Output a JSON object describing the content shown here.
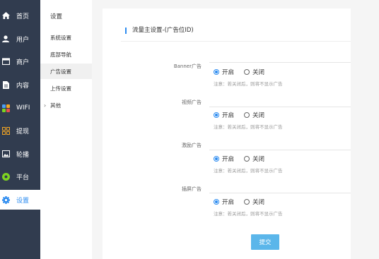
{
  "sidebar": {
    "items": [
      {
        "label": "首页",
        "icon": "home-icon",
        "color": "#ffffff"
      },
      {
        "label": "用户",
        "icon": "user-icon",
        "color": "#ffffff"
      },
      {
        "label": "商户",
        "icon": "store-icon",
        "color": "#ffffff"
      },
      {
        "label": "内容",
        "icon": "document-icon",
        "color": "#ffffff"
      },
      {
        "label": "WIFI",
        "icon": "wifi-apps-icon",
        "color": "#4a9ff5"
      },
      {
        "label": "提现",
        "icon": "grid-icon",
        "color": "#f5a623"
      },
      {
        "label": "轮播",
        "icon": "image-icon",
        "color": "#ffffff"
      },
      {
        "label": "平台",
        "icon": "platform-icon",
        "color": "#7ed321"
      },
      {
        "label": "设置",
        "icon": "gear-icon",
        "color": "#2d8cf0"
      }
    ],
    "active_index": 8
  },
  "submenu": {
    "title": "设置",
    "items": [
      {
        "label": "系统设置"
      },
      {
        "label": "底部导航"
      },
      {
        "label": "广告设置"
      },
      {
        "label": "上传设置"
      },
      {
        "label": "其他"
      }
    ],
    "active_index": 2
  },
  "form": {
    "title": "流量主设置-(广告位ID)",
    "fields": [
      {
        "label": "Banner广告",
        "on_label": "开启",
        "off_label": "关闭",
        "selected": "on",
        "note": "注意：若关闭后，则将不显示广告"
      },
      {
        "label": "视频广告",
        "on_label": "开启",
        "off_label": "关闭",
        "selected": "on",
        "note": "注意：若关闭后，则将不显示广告"
      },
      {
        "label": "激励广告",
        "on_label": "开启",
        "off_label": "关闭",
        "selected": "on",
        "note": "注意：若关闭后，则将不显示广告"
      },
      {
        "label": "插屏广告",
        "on_label": "开启",
        "off_label": "关闭",
        "selected": "on",
        "note": "注意：若关闭后，则将不显示广告"
      }
    ],
    "submit_label": "提交"
  },
  "colors": {
    "sidebar_bg": "#313c4f",
    "accent": "#2d8cf0",
    "submit_bg": "#5bb6ea"
  }
}
